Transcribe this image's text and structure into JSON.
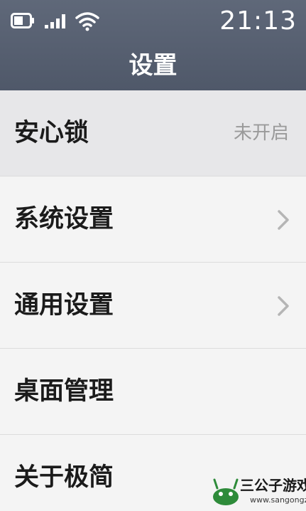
{
  "status_bar": {
    "time": "21:13",
    "icons": [
      "battery-icon",
      "signal-icon",
      "wifi-icon"
    ]
  },
  "header": {
    "title": "设置"
  },
  "settings": {
    "items": [
      {
        "label": "安心锁",
        "value": "未开启"
      },
      {
        "label": "系统设置",
        "icon": "chevron-right-icon"
      },
      {
        "label": "通用设置",
        "icon": "chevron-right-icon"
      },
      {
        "label": "桌面管理"
      },
      {
        "label": "关于极简"
      }
    ]
  },
  "watermark": {
    "text": "三公子游戏网",
    "url": "www.sangongzi.net"
  },
  "colors": {
    "header_bg": "#566073",
    "row_bg": "#f4f4f4",
    "first_row_bg": "#e7e7e9",
    "divider": "#dcdcdc",
    "label_text": "#1b1b1b",
    "value_text": "#9a9a9a",
    "chevron": "#b5b5b5"
  }
}
